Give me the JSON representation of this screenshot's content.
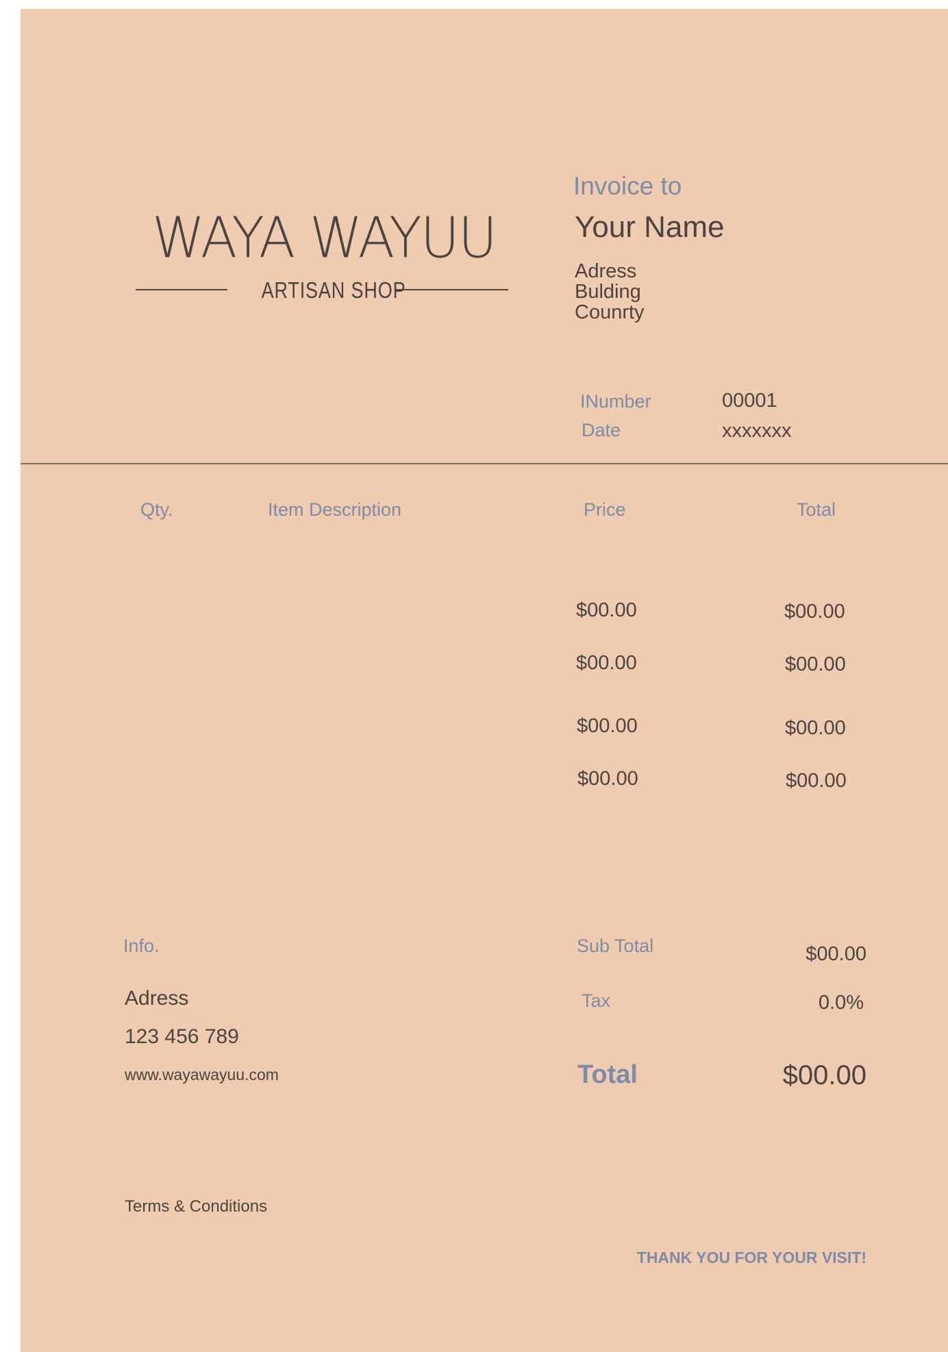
{
  "logo": {
    "brand": "WAYA WAYUU",
    "tagline": "ARTISAN SHOP"
  },
  "invoice_to": {
    "label": "Invoice to",
    "name": "Your Name",
    "address_lines": [
      "Adress",
      "Bulding",
      "Counrty"
    ]
  },
  "meta": {
    "number_label": "INumber",
    "number_value": "00001",
    "date_label": "Date",
    "date_value": "xxxxxxx"
  },
  "table": {
    "headers": {
      "qty": "Qty.",
      "description": "Item Description",
      "price": "Price",
      "total": "Total"
    },
    "rows": [
      {
        "price": "$00.00",
        "total": "$00.00"
      },
      {
        "price": "$00.00",
        "total": "$00.00"
      },
      {
        "price": "$00.00",
        "total": "$00.00"
      },
      {
        "price": "$00.00",
        "total": "$00.00"
      }
    ]
  },
  "info": {
    "label": "Info.",
    "address": "Adress",
    "phone": "123 456 789",
    "website": "www.wayawayuu.com"
  },
  "summary": {
    "subtotal_label": "Sub Total",
    "subtotal_value": "$00.00",
    "tax_label": "Tax",
    "tax_value": "0.0%",
    "total_label": "Total",
    "total_value": "$00.00"
  },
  "terms": "Terms & Conditions",
  "thanks": "THANK YOU FOR YOUR VISIT!",
  "colors": {
    "background": "#efcbb0",
    "accent": "#7d8ca8",
    "text": "#4a4444"
  }
}
